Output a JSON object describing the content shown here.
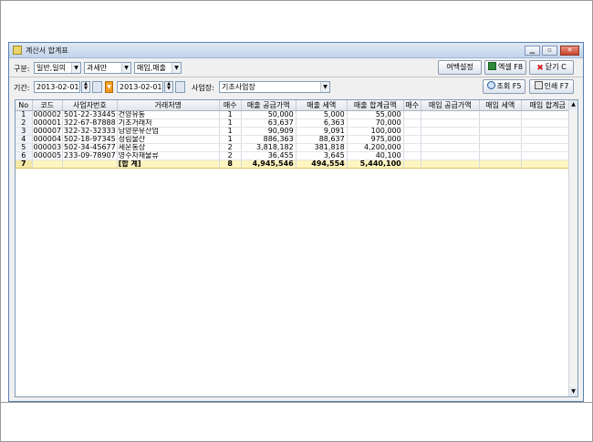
{
  "window": {
    "title": "계산서 합계표"
  },
  "toolbar1": {
    "gubun_label": "구분:",
    "gubun_value": "일반,일의",
    "tax_value": "과세만",
    "type_value": "매입,매출",
    "margin_btn": "여백설정",
    "excel_btn": "엑셀 F8",
    "close_btn": "닫기 C"
  },
  "toolbar2": {
    "period_label": "기간:",
    "date_from": "2013-02-01",
    "date_to": "2013-02-01",
    "site_label": "사업장:",
    "site_value": "기초사업장",
    "search_btn": "조회 F5",
    "print_btn": "인쇄 F7"
  },
  "table": {
    "headers": [
      "No",
      "코드",
      "사업자번호",
      "거래처명",
      "매수",
      "매출 공급가액",
      "매출 세액",
      "매출 합계금액",
      "매수",
      "매입 공급가액",
      "매입 세액",
      "매입 합계금"
    ],
    "rows": [
      [
        "1",
        "000002",
        "501-22-33445",
        "건양유통",
        "1",
        "50,000",
        "5,000",
        "55,000"
      ],
      [
        "2",
        "000001",
        "322-67-87888",
        "기초거래처",
        "1",
        "63,637",
        "6,363",
        "70,000"
      ],
      [
        "3",
        "000007",
        "322-32-32333",
        "남양분유산업",
        "1",
        "90,909",
        "9,091",
        "100,000"
      ],
      [
        "4",
        "000004",
        "502-18-97345",
        "성림물산",
        "1",
        "886,363",
        "88,637",
        "975,000"
      ],
      [
        "5",
        "000003",
        "502-34-45677",
        "세운통상",
        "2",
        "3,818,182",
        "381,818",
        "4,200,000"
      ],
      [
        "6",
        "000005",
        "233-09-78907",
        "영수자재물류",
        "2",
        "36,455",
        "3,645",
        "40,100"
      ]
    ],
    "total": [
      "7",
      "",
      "",
      "[합 계]",
      "8",
      "4,945,546",
      "494,554",
      "5,440,100"
    ]
  },
  "colors": {
    "total_row": "#fff5c0",
    "accent": "#f19c20",
    "border": "#7f9db9"
  },
  "icons": [
    "app-icon",
    "excel-icon",
    "close-x-icon",
    "search-icon",
    "printer-icon",
    "calendar-icon",
    "minimize-icon",
    "maximize-icon",
    "window-close-icon"
  ]
}
